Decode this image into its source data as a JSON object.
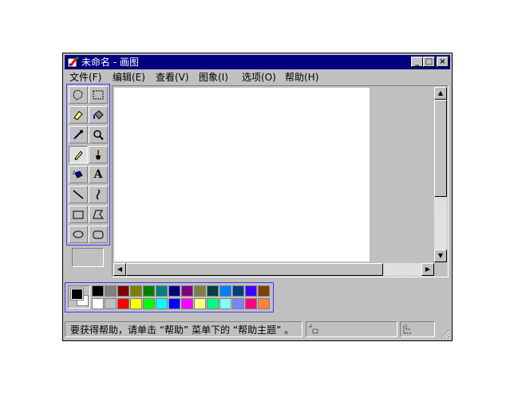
{
  "window": {
    "title": "未命名 - 画图",
    "controls": {
      "minimize": "_",
      "maximize": "□",
      "close": "×"
    }
  },
  "menu": [
    {
      "label": "文件(F)"
    },
    {
      "label": "编辑(E)"
    },
    {
      "label": "查看(V)"
    },
    {
      "label": "图象(I)"
    },
    {
      "label": "选项(O)"
    },
    {
      "label": "帮助(H)"
    }
  ],
  "tools": [
    {
      "name": "free-form-select-icon"
    },
    {
      "name": "select-icon"
    },
    {
      "name": "eraser-icon"
    },
    {
      "name": "fill-with-color-icon"
    },
    {
      "name": "pick-color-icon"
    },
    {
      "name": "magnifier-icon"
    },
    {
      "name": "pencil-icon",
      "selected": true
    },
    {
      "name": "brush-icon"
    },
    {
      "name": "airbrush-icon"
    },
    {
      "name": "text-icon",
      "glyph": "A"
    },
    {
      "name": "line-icon"
    },
    {
      "name": "curve-icon"
    },
    {
      "name": "rectangle-icon"
    },
    {
      "name": "polygon-icon"
    },
    {
      "name": "ellipse-icon"
    },
    {
      "name": "rounded-rectangle-icon"
    }
  ],
  "colors": {
    "foreground": "#000000",
    "background": "#ffffff",
    "row1": [
      "#000000",
      "#808080",
      "#800000",
      "#808000",
      "#008000",
      "#008080",
      "#000080",
      "#800080",
      "#808040",
      "#004040",
      "#0080ff",
      "#004080",
      "#4000ff",
      "#804000"
    ],
    "row2": [
      "#ffffff",
      "#c0c0c0",
      "#ff0000",
      "#ffff00",
      "#00ff00",
      "#00ffff",
      "#0000ff",
      "#ff00ff",
      "#ffff80",
      "#00ff80",
      "#80ffff",
      "#8080ff",
      "#ff0080",
      "#ff8040"
    ]
  },
  "status": {
    "help_text": "要获得帮助，请单击 “帮助” 菜单下的 “帮助主题” 。"
  }
}
